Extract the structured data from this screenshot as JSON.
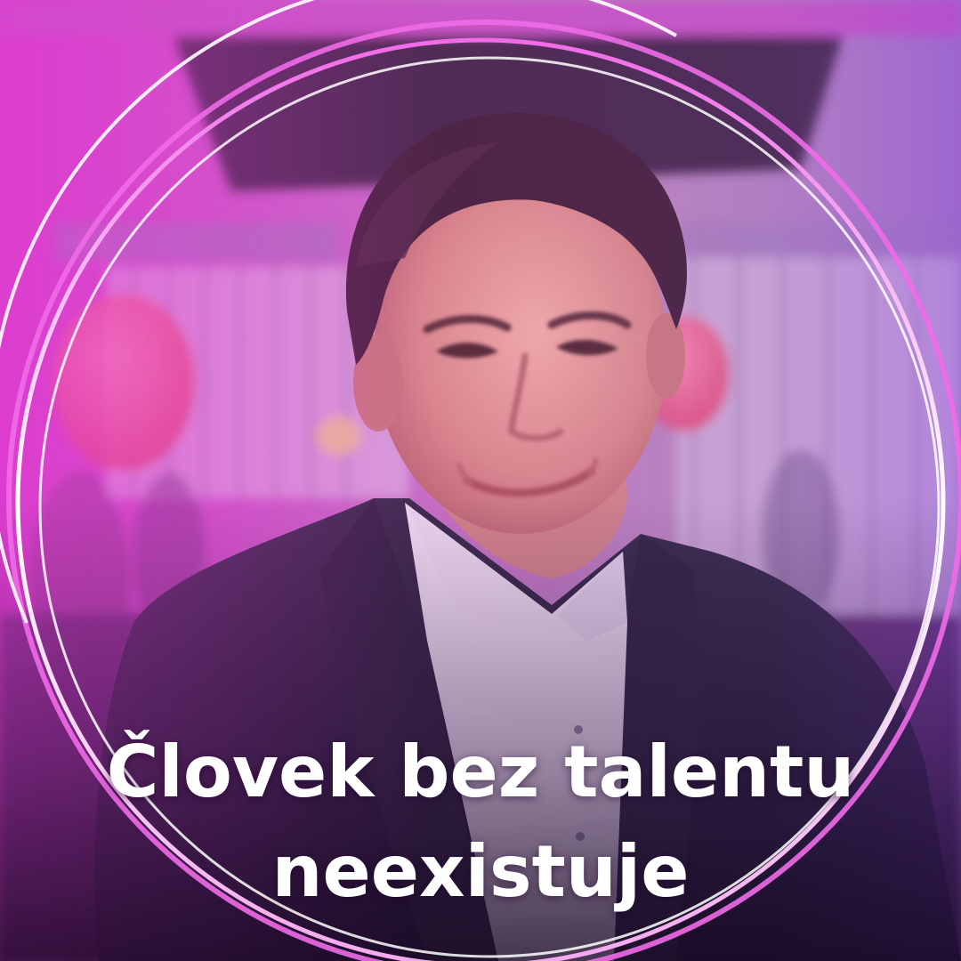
{
  "caption": {
    "line1": "Človek bez talentu",
    "line2": "neexistuje"
  },
  "colors": {
    "accent_magenta": "#e13ad6",
    "ring_white": "#ffffff",
    "ring_pink": "#f06be8",
    "shadow_purple": "#2a1342"
  },
  "photo": {
    "subject": "smiling middle-aged man with dark hair in navy blazer and white shirt",
    "background": "blurred street scene with building and red balloons"
  }
}
